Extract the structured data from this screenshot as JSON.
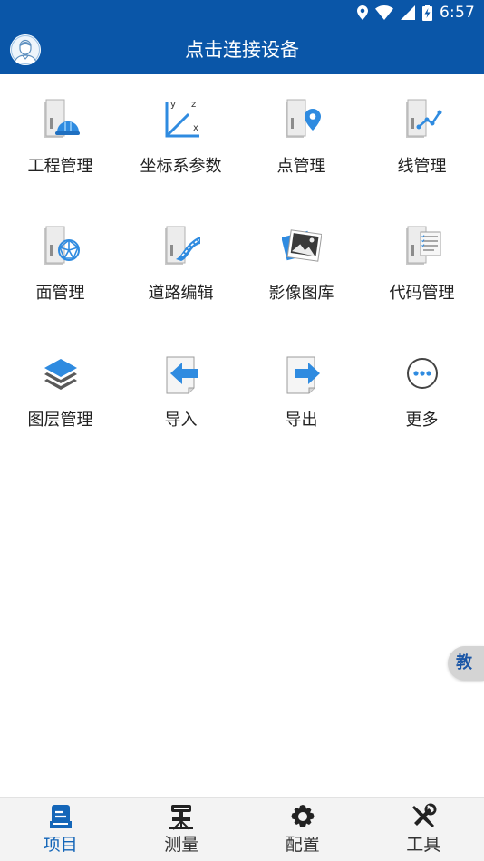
{
  "status_bar": {
    "time": "6:57",
    "icons": [
      "location-icon",
      "wifi-icon",
      "signal-icon",
      "battery-charging-icon"
    ]
  },
  "header": {
    "title": "点击连接设备",
    "avatar_icon": "user-avatar-icon"
  },
  "grid": {
    "items": [
      {
        "label": "工程管理",
        "icon": "project-folder-helmet-icon"
      },
      {
        "label": "坐标系参数",
        "icon": "coordinate-axes-icon"
      },
      {
        "label": "点管理",
        "icon": "point-folder-pin-icon"
      },
      {
        "label": "线管理",
        "icon": "line-folder-icon"
      },
      {
        "label": "面管理",
        "icon": "surface-folder-mesh-icon"
      },
      {
        "label": "道路编辑",
        "icon": "road-edit-folder-icon"
      },
      {
        "label": "影像图库",
        "icon": "image-gallery-icon"
      },
      {
        "label": "代码管理",
        "icon": "code-list-folder-icon"
      },
      {
        "label": "图层管理",
        "icon": "layers-icon"
      },
      {
        "label": "导入",
        "icon": "import-arrow-icon"
      },
      {
        "label": "导出",
        "icon": "export-arrow-icon"
      },
      {
        "label": "更多",
        "icon": "more-dots-icon"
      }
    ]
  },
  "tutorial_button": {
    "label": "教"
  },
  "bottom_nav": {
    "active_index": 0,
    "items": [
      {
        "label": "项目",
        "icon": "project-icon"
      },
      {
        "label": "测量",
        "icon": "survey-instrument-icon"
      },
      {
        "label": "配置",
        "icon": "gear-icon"
      },
      {
        "label": "工具",
        "icon": "tools-icon"
      }
    ]
  },
  "colors": {
    "primary": "#0a56a8",
    "active_tab": "#1466b8",
    "text": "#222222",
    "icon_blue": "#2f8be0"
  }
}
